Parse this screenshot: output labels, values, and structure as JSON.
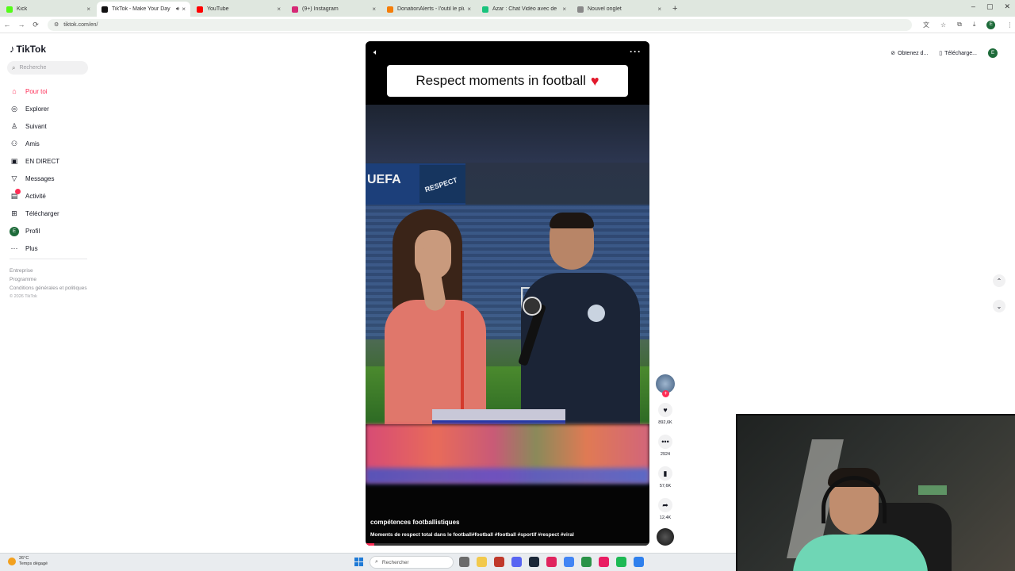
{
  "browser": {
    "tabs": [
      {
        "label": "Kick",
        "color": "#53fc18",
        "active": false
      },
      {
        "label": "TikTok - Make Your Day",
        "color": "#111111",
        "active": true
      },
      {
        "label": "YouTube",
        "color": "#ff0000",
        "active": false
      },
      {
        "label": "(9+) Instagram",
        "color": "#d62976",
        "active": false
      },
      {
        "label": "DonationAlerts - l'outil le plus",
        "color": "#f57d07",
        "active": false
      },
      {
        "label": "Azar : Chat Vidéo avec de",
        "color": "#19c37d",
        "active": false
      },
      {
        "label": "Nouvel onglet",
        "color": "#888888",
        "active": false
      }
    ],
    "url": "tiktok.com/en/",
    "profile_initial": "E"
  },
  "tiktok": {
    "logo": "TikTok",
    "search_placeholder": "Recherche",
    "nav": [
      {
        "label": "Pour toi",
        "icon": "home-icon",
        "active": true
      },
      {
        "label": "Explorer",
        "icon": "compass-icon"
      },
      {
        "label": "Suivant",
        "icon": "following-icon"
      },
      {
        "label": "Amis",
        "icon": "friends-icon"
      },
      {
        "label": "EN DIRECT",
        "icon": "live-icon"
      },
      {
        "label": "Messages",
        "icon": "send-icon"
      },
      {
        "label": "Activité",
        "icon": "inbox-icon",
        "badge": true
      },
      {
        "label": "Télécharger",
        "icon": "upload-icon"
      },
      {
        "label": "Profil",
        "icon": "profile-icon",
        "initial": "E"
      },
      {
        "label": "Plus",
        "icon": "more-icon"
      }
    ],
    "footer": {
      "link1": "Entreprise",
      "link2": "Programme",
      "link3": "Conditions générales et politiques",
      "copyright": "© 2026 TikTok"
    },
    "topbar": {
      "get_coins": "Obtenez d...",
      "download_app": "Télécharge...",
      "profile_initial": "E"
    },
    "video": {
      "title_card": "Respect moments in football",
      "author": "compétences footballistiques",
      "caption": "Moments de respect total dans le football#football #football #sportif #respect #viral",
      "progress": 0.03,
      "scene_uefa": "UEFA",
      "scene_respect": "RESPECT"
    },
    "actions": {
      "likes": "892,6K",
      "comments": "2924",
      "saves": "57,6K",
      "shares": "12,4K"
    }
  },
  "taskbar": {
    "weather_temp": "26°C",
    "weather_desc": "Temps dégagé",
    "search_placeholder": "Rechercher",
    "apps": [
      "#6b6b6b",
      "#f2c94c",
      "#c0392b",
      "#5865f2",
      "#1b2838",
      "#e0245e",
      "#4285f4",
      "#2b9348",
      "#e91e63",
      "#1db954",
      "#2f80ed"
    ]
  }
}
